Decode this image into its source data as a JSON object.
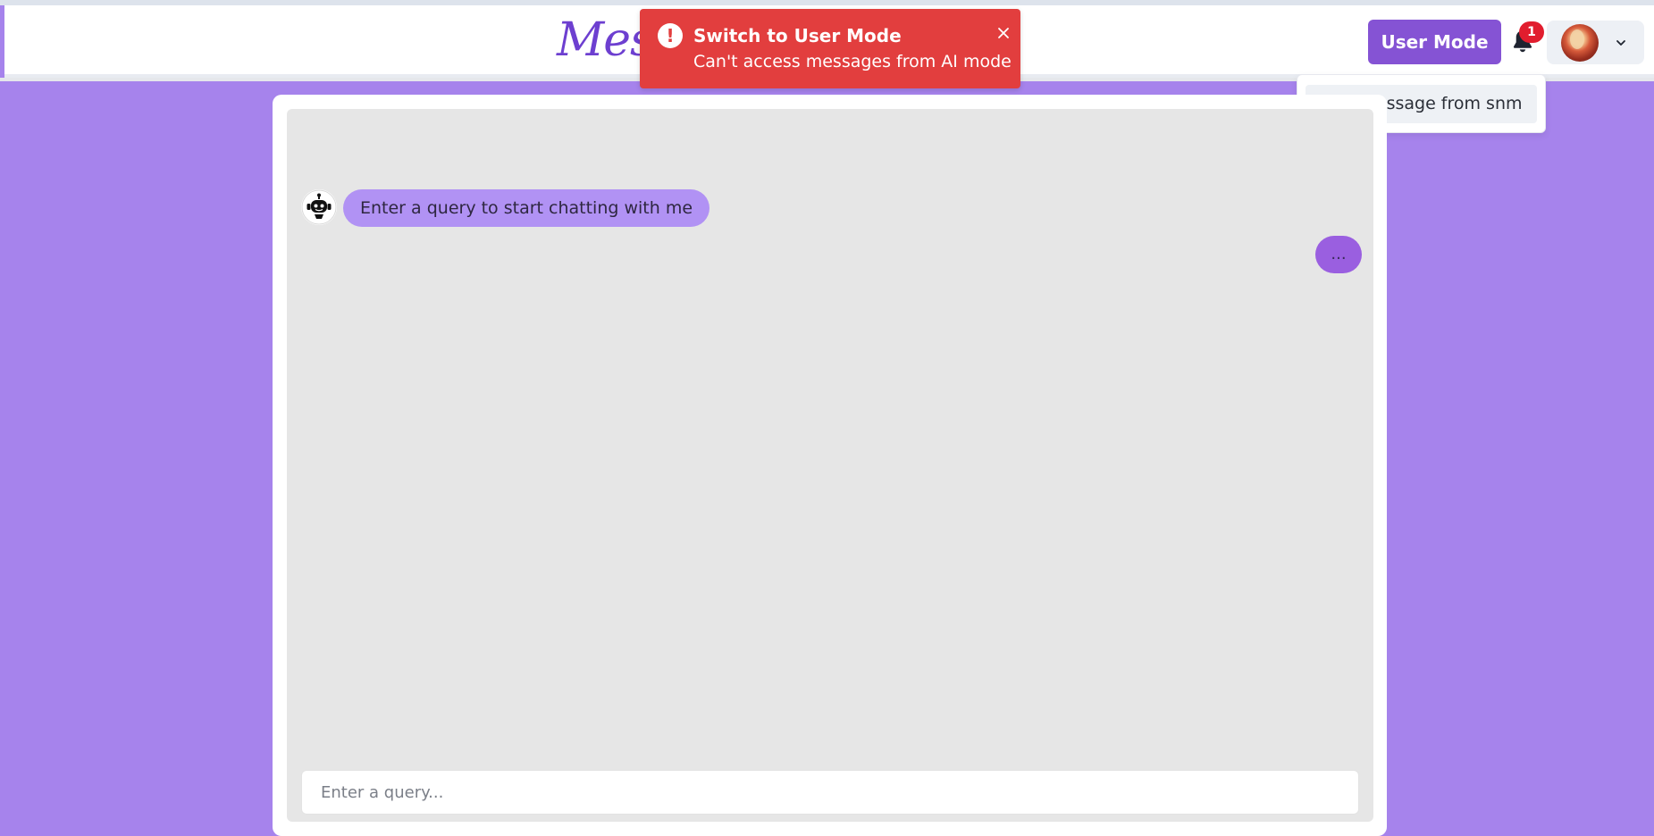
{
  "app": {
    "logo_text": "Mes"
  },
  "header": {
    "mode_button_label": "User Mode",
    "notification_count": "1",
    "bell_icon": "bell-icon",
    "profile_chevron_icon": "chevron-down-icon"
  },
  "toast": {
    "title": "Switch to User Mode",
    "message": "Can't access messages from AI mode",
    "icon": "exclamation-icon",
    "close_icon": "close-icon",
    "color": "#e23e3e"
  },
  "notifications_menu": {
    "items": [
      {
        "label": "New Message from snm"
      }
    ]
  },
  "chat": {
    "messages": [
      {
        "role": "user",
        "text": "..."
      },
      {
        "role": "bot",
        "text": "Enter a query to start chatting with me",
        "icon": "robot-icon"
      }
    ],
    "input": {
      "value": "",
      "placeholder": "Enter a query..."
    }
  },
  "colors": {
    "background": "#a683ec",
    "accent": "#8553d4",
    "bot_bubble": "#b192f4",
    "user_bubble": "#9a5fe0",
    "badge": "#e11d2e"
  }
}
